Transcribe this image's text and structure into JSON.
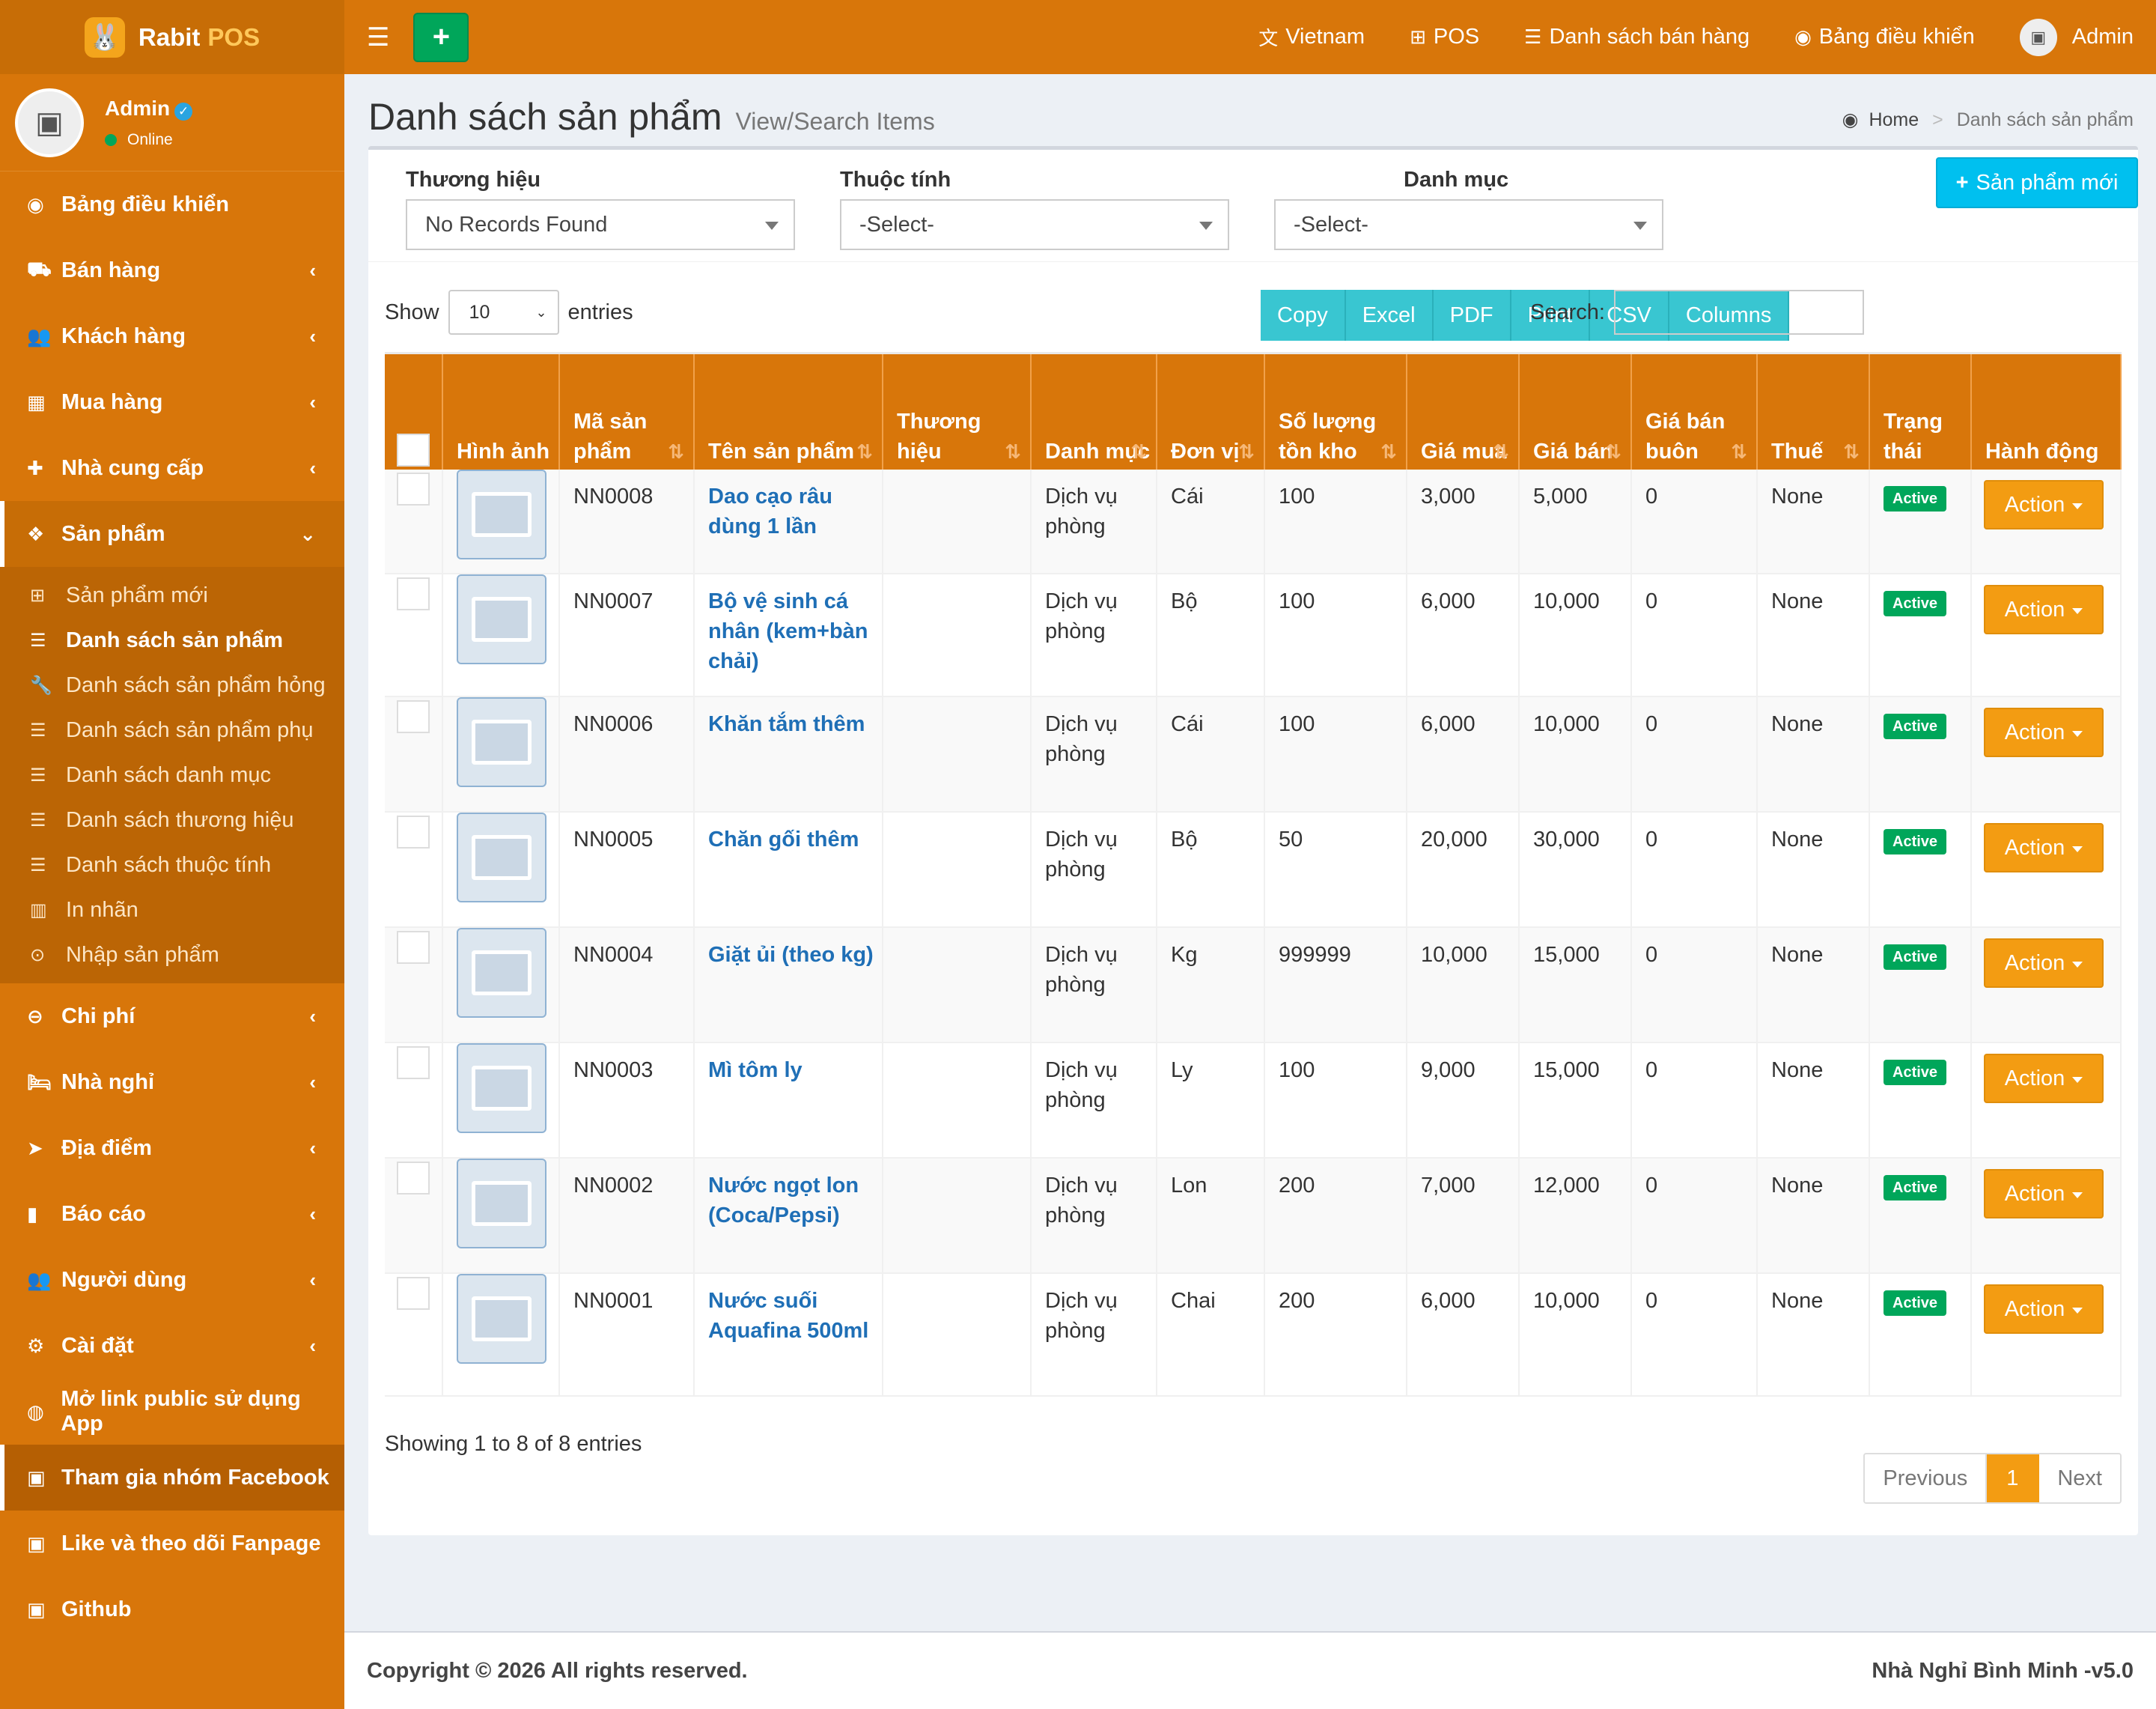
{
  "app": {
    "name": "Rabit",
    "name_accent": "POS"
  },
  "user": {
    "name": "Admin",
    "status": "Online"
  },
  "sidebar": {
    "items": [
      {
        "label": "Bảng điều khiển",
        "icon": "dashboard-icon",
        "chev": ""
      },
      {
        "label": "Bán hàng",
        "icon": "cart-icon",
        "chev": "‹"
      },
      {
        "label": "Khách hàng",
        "icon": "users-icon",
        "chev": "‹"
      },
      {
        "label": "Mua hàng",
        "icon": "grid-icon",
        "chev": "‹"
      },
      {
        "label": "Nhà cung cấp",
        "icon": "user-plus-icon",
        "chev": "‹"
      }
    ],
    "open": {
      "label": "Sản phẩm",
      "icon": "cubes-icon",
      "chev": "⌄"
    },
    "subitems": [
      {
        "label": "Sản phẩm mới",
        "icon": "plus-square-icon"
      },
      {
        "label": "Danh sách sản phẩm",
        "icon": "list-icon"
      },
      {
        "label": "Danh sách sản phẩm hỏng",
        "icon": "wrench-icon"
      },
      {
        "label": "Danh sách sản phẩm phụ",
        "icon": "list-icon"
      },
      {
        "label": "Danh sách danh mục",
        "icon": "list-icon"
      },
      {
        "label": "Danh sách thương hiệu",
        "icon": "list-icon"
      },
      {
        "label": "Danh sách thuộc tính",
        "icon": "list-icon"
      },
      {
        "label": "In nhãn",
        "icon": "barcode-icon"
      },
      {
        "label": "Nhập sản phẩm",
        "icon": "arrow-circle-icon"
      }
    ],
    "items2": [
      {
        "label": "Chi phí",
        "icon": "minus-circle-icon",
        "chev": "‹"
      },
      {
        "label": "Nhà nghỉ",
        "icon": "bed-icon",
        "chev": "‹"
      },
      {
        "label": "Địa điểm",
        "icon": "location-arrow-icon",
        "chev": "‹"
      },
      {
        "label": "Báo cáo",
        "icon": "bar-chart-icon",
        "chev": "‹"
      },
      {
        "label": "Người dùng",
        "icon": "users-icon",
        "chev": "‹"
      },
      {
        "label": "Cài đặt",
        "icon": "cogs-icon",
        "chev": "‹"
      },
      {
        "label": "Mở link public sử dụng App",
        "icon": "globe-icon",
        "chev": ""
      },
      {
        "label": "Tham gia nhóm Facebook",
        "icon": "briefcase-icon",
        "chev": ""
      },
      {
        "label": "Like và theo dõi Fanpage",
        "icon": "briefcase-icon",
        "chev": ""
      },
      {
        "label": "Github",
        "icon": "briefcase-icon",
        "chev": ""
      }
    ]
  },
  "topnav": {
    "links": [
      {
        "label": "Vietnam",
        "icon": "language-icon"
      },
      {
        "label": "POS",
        "icon": "plus-square-icon"
      },
      {
        "label": "Danh sách bán hàng",
        "icon": "list-icon"
      },
      {
        "label": "Bảng điều khiển",
        "icon": "dashboard-icon"
      }
    ],
    "user": "Admin"
  },
  "page": {
    "title": "Danh sách sản phẩm",
    "subtitle": "View/Search Items",
    "breadcrumb_home": "Home",
    "breadcrumb_sep": ">",
    "breadcrumb_current": "Danh sách sản phẩm"
  },
  "filters": {
    "brand_label": "Thương hiệu",
    "brand_value": "No Records Found",
    "attr_label": "Thuộc tính",
    "attr_value": "-Select-",
    "cat_label": "Danh mục",
    "cat_value": "-Select-",
    "new_button": "Sản phẩm mới"
  },
  "controls": {
    "show": "Show",
    "entries_value": "10",
    "entries": "entries",
    "buttons": [
      "Copy",
      "Excel",
      "PDF",
      "Print",
      "CSV",
      "Columns"
    ],
    "search_label": "Search:"
  },
  "table": {
    "headers": [
      "Hình ảnh",
      "Mã sản phẩm",
      "Tên sản phẩm",
      "Thương hiệu",
      "Danh mục",
      "Đơn vị",
      "Số lượng tồn kho",
      "Giá mua",
      "Giá bán",
      "Giá bán buôn",
      "Thuế",
      "Trạng thái",
      "Hành động"
    ],
    "rows": [
      {
        "code": "NN0008",
        "name": "Dao cạo râu dùng 1 lần",
        "brand": "",
        "category": "Dịch vụ phòng",
        "unit": "Cái",
        "qty": "100",
        "buy": "3,000",
        "sell": "5,000",
        "wholesale": "0",
        "tax": "None",
        "status": "Active",
        "action": "Action"
      },
      {
        "code": "NN0007",
        "name": "Bộ vệ sinh cá nhân (kem+bàn chải)",
        "brand": "",
        "category": "Dịch vụ phòng",
        "unit": "Bộ",
        "qty": "100",
        "buy": "6,000",
        "sell": "10,000",
        "wholesale": "0",
        "tax": "None",
        "status": "Active",
        "action": "Action"
      },
      {
        "code": "NN0006",
        "name": "Khăn tắm thêm",
        "brand": "",
        "category": "Dịch vụ phòng",
        "unit": "Cái",
        "qty": "100",
        "buy": "6,000",
        "sell": "10,000",
        "wholesale": "0",
        "tax": "None",
        "status": "Active",
        "action": "Action"
      },
      {
        "code": "NN0005",
        "name": "Chăn gối thêm",
        "brand": "",
        "category": "Dịch vụ phòng",
        "unit": "Bộ",
        "qty": "50",
        "buy": "20,000",
        "sell": "30,000",
        "wholesale": "0",
        "tax": "None",
        "status": "Active",
        "action": "Action"
      },
      {
        "code": "NN0004",
        "name": "Giặt ủi (theo kg)",
        "brand": "",
        "category": "Dịch vụ phòng",
        "unit": "Kg",
        "qty": "999999",
        "buy": "10,000",
        "sell": "15,000",
        "wholesale": "0",
        "tax": "None",
        "status": "Active",
        "action": "Action"
      },
      {
        "code": "NN0003",
        "name": "Mì tôm ly",
        "brand": "",
        "category": "Dịch vụ phòng",
        "unit": "Ly",
        "qty": "100",
        "buy": "9,000",
        "sell": "15,000",
        "wholesale": "0",
        "tax": "None",
        "status": "Active",
        "action": "Action"
      },
      {
        "code": "NN0002",
        "name": "Nước ngọt lon (Coca/Pepsi)",
        "brand": "",
        "category": "Dịch vụ phòng",
        "unit": "Lon",
        "qty": "200",
        "buy": "7,000",
        "sell": "12,000",
        "wholesale": "0",
        "tax": "None",
        "status": "Active",
        "action": "Action"
      },
      {
        "code": "NN0001",
        "name": "Nước suối Aquafina 500ml",
        "brand": "",
        "category": "Dịch vụ phòng",
        "unit": "Chai",
        "qty": "200",
        "buy": "6,000",
        "sell": "10,000",
        "wholesale": "0",
        "tax": "None",
        "status": "Active",
        "action": "Action"
      }
    ],
    "info": "Showing 1 to 8 of 8 entries"
  },
  "pagination": {
    "prev": "Previous",
    "current": "1",
    "next": "Next"
  },
  "footer": {
    "copyright": "Copyright © 2026 All rights reserved.",
    "version": "Nhà Nghỉ Bình Minh -v5.0"
  }
}
